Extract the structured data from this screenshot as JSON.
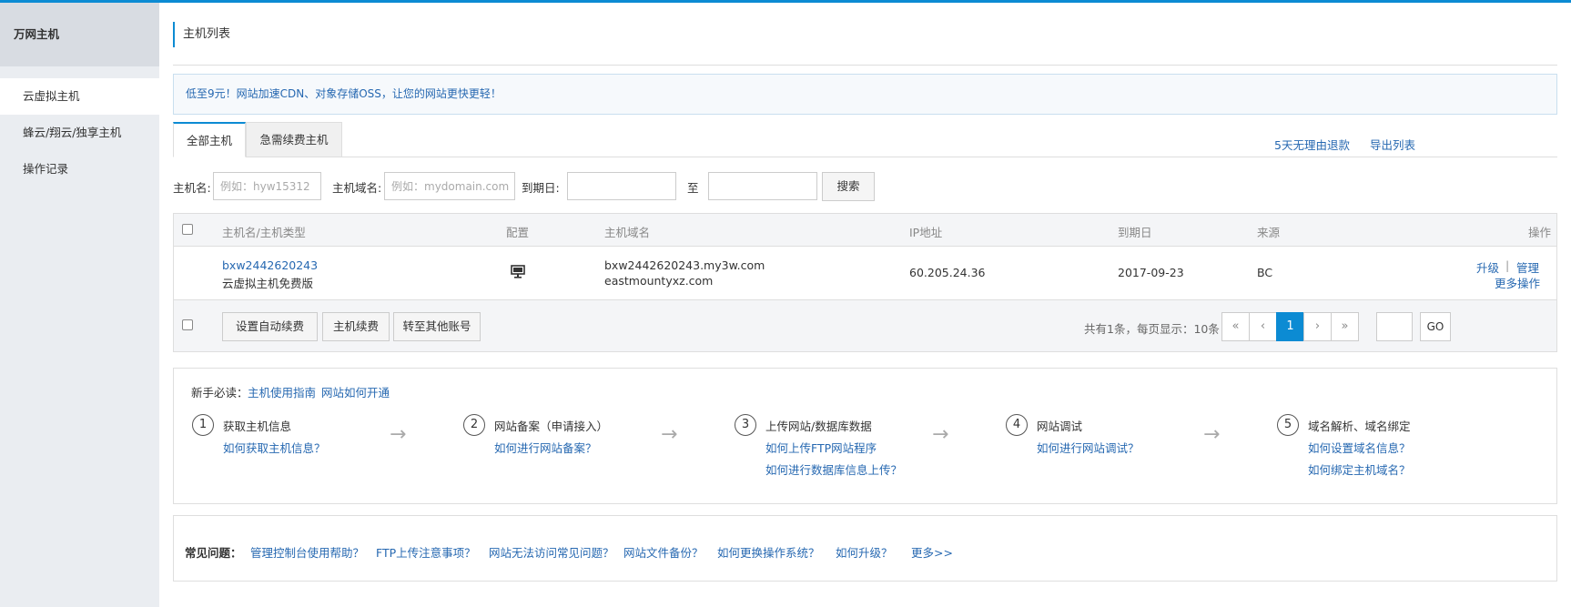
{
  "sidebar": {
    "title": "万网主机",
    "items": [
      {
        "label": "云虚拟主机",
        "active": true
      },
      {
        "label": "蜂云/翔云/独享主机",
        "active": false
      },
      {
        "label": "操作记录",
        "active": false
      }
    ]
  },
  "page": {
    "title": "主机列表"
  },
  "notice": "低至9元！网站加速CDN、对象存储OSS，让您的网站更快更轻！",
  "tabs": [
    {
      "label": "全部主机",
      "active": true
    },
    {
      "label": "急需续费主机",
      "active": false
    }
  ],
  "top_links": {
    "refund": "5天无理由退款",
    "export": "导出列表"
  },
  "filters": {
    "host_name_label": "主机名:",
    "host_name_placeholder": "例如：hyw15312",
    "domain_label": "主机域名:",
    "domain_placeholder": "例如：mydomain.com",
    "expire_label": "到期日:",
    "to_label": "至",
    "search_button": "搜索"
  },
  "table": {
    "columns": [
      "主机名/主机类型",
      "配置",
      "主机域名",
      "IP地址",
      "到期日",
      "来源",
      "操作"
    ],
    "rows": [
      {
        "host_name": "bxw2442620243",
        "host_type": "云虚拟主机免费版",
        "domain1": "bxw2442620243.my3w.com",
        "domain2": "eastmountyxz.com",
        "ip": "60.205.24.36",
        "expire": "2017-09-23",
        "source": "BC",
        "action_upgrade": "升级",
        "action_sep": "|",
        "action_manage": "管理",
        "action_more": "更多操作"
      }
    ],
    "footer_buttons": [
      "设置自动续费",
      "主机续费",
      "转至其他账号"
    ],
    "pagination": {
      "summary": "共有1条，每页显示：10条",
      "first": "«",
      "prev": "‹",
      "current": "1",
      "next": "›",
      "last": "»",
      "go": "GO"
    }
  },
  "guide": {
    "prefix": "新手必读：",
    "links": [
      "主机使用指南",
      "网站如何开通"
    ],
    "arrow": "→",
    "steps": [
      {
        "num": "1",
        "title": "获取主机信息",
        "links": [
          "如何获取主机信息？"
        ]
      },
      {
        "num": "2",
        "title": "网站备案（申请接入）",
        "links": [
          "如何进行网站备案？"
        ]
      },
      {
        "num": "3",
        "title": "上传网站/数据库数据",
        "links": [
          "如何上传FTP网站程序",
          "如何进行数据库信息上传？"
        ]
      },
      {
        "num": "4",
        "title": "网站调试",
        "links": [
          "如何进行网站调试？"
        ]
      },
      {
        "num": "5",
        "title": "域名解析、域名绑定",
        "links": [
          "如何设置域名信息？",
          "如何绑定主机域名？"
        ]
      }
    ]
  },
  "faq": {
    "label": "常见问题：",
    "links": [
      "管理控制台使用帮助？",
      "FTP上传注意事项？",
      "网站无法访问常见问题？",
      "网站文件备份？",
      "如何更换操作系统？",
      "如何升级？",
      "更多>>"
    ]
  },
  "colors": {
    "accent": "#0c8bd3",
    "link": "#2668b1",
    "sidebar_bg": "#eaedf1"
  },
  "icons": {
    "config": "monitor-icon",
    "step_arrow": "arrow-right-icon"
  }
}
